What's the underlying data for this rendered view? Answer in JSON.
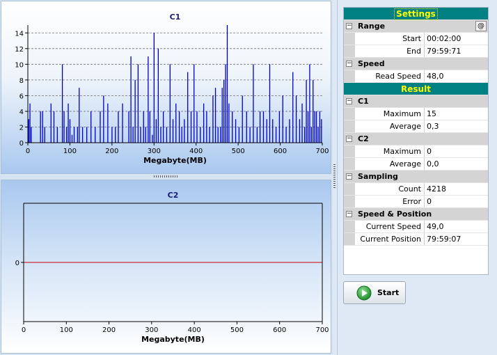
{
  "charts": [
    {
      "id": "c1",
      "chart_data": {
        "type": "bar",
        "title": "C1",
        "xlabel": "Megabyte(MB)",
        "ylabel": "",
        "xlim": [
          0,
          700
        ],
        "ylim": [
          0,
          15
        ],
        "xticks": [
          0,
          100,
          200,
          300,
          400,
          500,
          600,
          700
        ],
        "yticks": [
          0,
          2,
          4,
          6,
          8,
          10,
          12,
          14
        ],
        "grid": "horizontal dashed",
        "series": [
          {
            "color": "#0000cc",
            "x": [
              2,
              5,
              8,
              30,
              35,
              40,
              55,
              62,
              70,
              82,
              86,
              92,
              96,
              100,
              105,
              110,
              118,
              122,
              130,
              140,
              150,
              160,
              172,
              180,
              190,
              200,
              208,
              215,
              225,
              240,
              245,
              250,
              255,
              262,
              268,
              275,
              280,
              286,
              290,
              296,
              300,
              305,
              310,
              316,
              322,
              330,
              338,
              345,
              352,
              360,
              366,
              372,
              380,
              388,
              395,
              402,
              410,
              418,
              425,
              432,
              440,
              446,
              452,
              458,
              462,
              466,
              470,
              474,
              478,
              486,
              494,
              502,
              510,
              520,
              528,
              536,
              545,
              552,
              560,
              568,
              575,
              582,
              590,
              598,
              606,
              614,
              622,
              630,
              638,
              646,
              652,
              658,
              662,
              666,
              670,
              674,
              678,
              682,
              686,
              690,
              694,
              698
            ],
            "values": [
              3,
              5,
              2,
              4,
              4,
              2,
              5,
              4,
              2,
              10,
              4,
              2,
              5,
              3,
              1,
              2,
              2,
              7,
              2,
              2,
              4,
              2,
              4,
              6,
              5,
              2,
              2,
              4,
              5,
              4,
              11,
              2,
              8,
              10,
              2,
              4,
              2,
              11,
              4,
              1,
              14,
              3,
              12,
              2,
              4,
              2,
              10,
              3,
              5,
              4,
              2,
              3,
              9,
              4,
              10,
              4,
              2,
              5,
              4,
              2,
              6,
              7,
              2,
              2,
              7,
              8,
              10,
              15,
              5,
              4,
              3,
              2,
              6,
              4,
              2,
              10,
              2,
              4,
              4,
              3,
              10,
              3,
              2,
              4,
              6,
              2,
              3,
              9,
              6,
              3,
              5,
              2,
              8,
              4,
              10,
              2,
              8,
              4,
              4,
              2,
              4,
              3
            ]
          }
        ]
      }
    },
    {
      "id": "c2",
      "chart_data": {
        "type": "line",
        "title": "C2",
        "xlabel": "Megabyte(MB)",
        "ylabel": "",
        "xlim": [
          0,
          700
        ],
        "xticks": [
          0,
          100,
          200,
          300,
          400,
          500,
          600,
          700
        ],
        "yticks": [
          0
        ],
        "grid": "off",
        "series": [
          {
            "color": "#cc0000",
            "x": [
              0,
              700
            ],
            "values": [
              0,
              0
            ]
          }
        ]
      }
    }
  ],
  "panel": {
    "settings_header": "Settings",
    "result_header": "Result",
    "range": {
      "label": "Range",
      "at_button": "@",
      "start_label": "Start",
      "start_value": "00:02:00",
      "end_label": "End",
      "end_value": "79:59:71"
    },
    "speed": {
      "label": "Speed",
      "read_speed_label": "Read Speed",
      "read_speed_value": "48,0"
    },
    "c1": {
      "label": "C1",
      "max_label": "Maximum",
      "max_value": "15",
      "avg_label": "Average",
      "avg_value": "0,3"
    },
    "c2": {
      "label": "C2",
      "max_label": "Maximum",
      "max_value": "0",
      "avg_label": "Average",
      "avg_value": "0,0"
    },
    "sampling": {
      "label": "Sampling",
      "count_label": "Count",
      "count_value": "4218",
      "error_label": "Error",
      "error_value": "0"
    },
    "speed_pos": {
      "label": "Speed & Position",
      "cur_speed_label": "Current Speed",
      "cur_speed_value": "49,0",
      "cur_pos_label": "Current Position",
      "cur_pos_value": "79:59:07"
    },
    "collapse_glyph": "−"
  },
  "start_button": {
    "label": "Start",
    "icon": "play-icon",
    "accent": "#2a9b3a"
  }
}
